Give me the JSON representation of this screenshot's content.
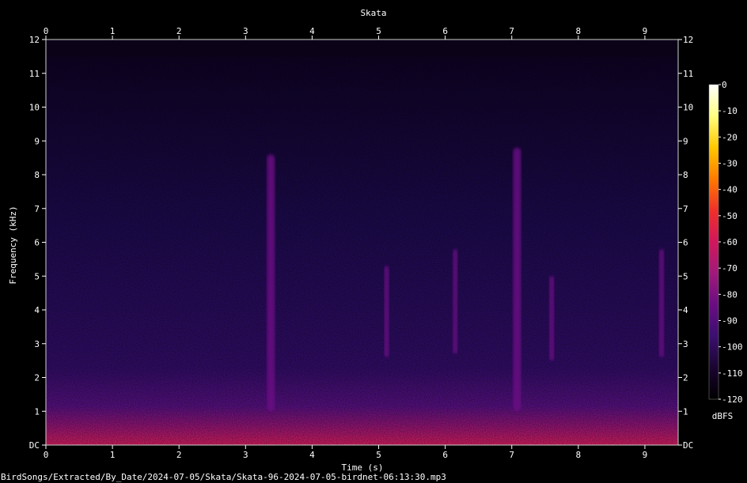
{
  "chart_data": {
    "type": "heatmap",
    "title": "Skata",
    "xlabel": "Time (s)",
    "ylabel": "Frequency (kHz)",
    "xlim": [
      0,
      9.5
    ],
    "ylim": [
      0,
      12
    ],
    "x_ticks": [
      "0",
      "1",
      "2",
      "3",
      "4",
      "5",
      "6",
      "7",
      "8",
      "9"
    ],
    "y_ticks": [
      "DC",
      "1",
      "2",
      "3",
      "4",
      "5",
      "6",
      "7",
      "8",
      "9",
      "10",
      "11",
      "12"
    ],
    "noise_ceiling_khz": 11.5,
    "colorbar": {
      "label": "dBFS",
      "range": [
        -120,
        0
      ],
      "ticks": [
        "0",
        "-10",
        "-20",
        "-30",
        "-40",
        "-50",
        "-60",
        "-70",
        "-80",
        "-90",
        "-100",
        "-110",
        "-120"
      ],
      "colors": [
        "#000000",
        "#1a0530",
        "#3b0f70",
        "#6a0d83",
        "#a01a7a",
        "#d1175c",
        "#f0302a",
        "#ff7a00",
        "#ffc800",
        "#ffff80",
        "#ffffff"
      ]
    },
    "calls": [
      {
        "t": 3.38,
        "f_low": 1.0,
        "f_high": 8.6,
        "level_db": -80
      },
      {
        "t": 5.12,
        "f_low": 2.6,
        "f_high": 5.3,
        "level_db": -88
      },
      {
        "t": 6.15,
        "f_low": 2.7,
        "f_high": 5.8,
        "level_db": -88
      },
      {
        "t": 7.08,
        "f_low": 1.0,
        "f_high": 8.8,
        "level_db": -80
      },
      {
        "t": 7.6,
        "f_low": 2.5,
        "f_high": 5.0,
        "level_db": -90
      },
      {
        "t": 9.25,
        "f_low": 2.6,
        "f_high": 5.8,
        "level_db": -90
      }
    ]
  },
  "footer": {
    "file_path": "BirdSongs/Extracted/By_Date/2024-07-05/Skata/Skata-96-2024-07-05-birdnet-06:13:30.mp3"
  }
}
